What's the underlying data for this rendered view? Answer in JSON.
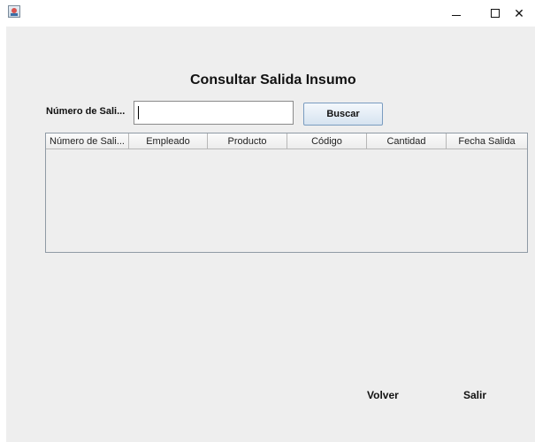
{
  "window": {
    "minimize_glyph": "",
    "maximize_glyph": "",
    "close_glyph": "✕"
  },
  "page": {
    "title": "Consultar Salida Insumo"
  },
  "search": {
    "label": "Número de Sali...",
    "value": "",
    "button_label": "Buscar"
  },
  "table": {
    "columns": [
      "Número de Sali...",
      "Empleado",
      "Producto",
      "Código",
      "Cantidad",
      "Fecha Salida"
    ],
    "rows": []
  },
  "footer": {
    "back_label": "Volver",
    "exit_label": "Salir"
  },
  "colors": {
    "panel_background": "#eeeeee",
    "button_border": "#7a9cc0"
  },
  "icons": {
    "app": "java-app-icon",
    "minimize": "minimize-icon",
    "maximize": "maximize-icon",
    "close": "close-icon"
  }
}
